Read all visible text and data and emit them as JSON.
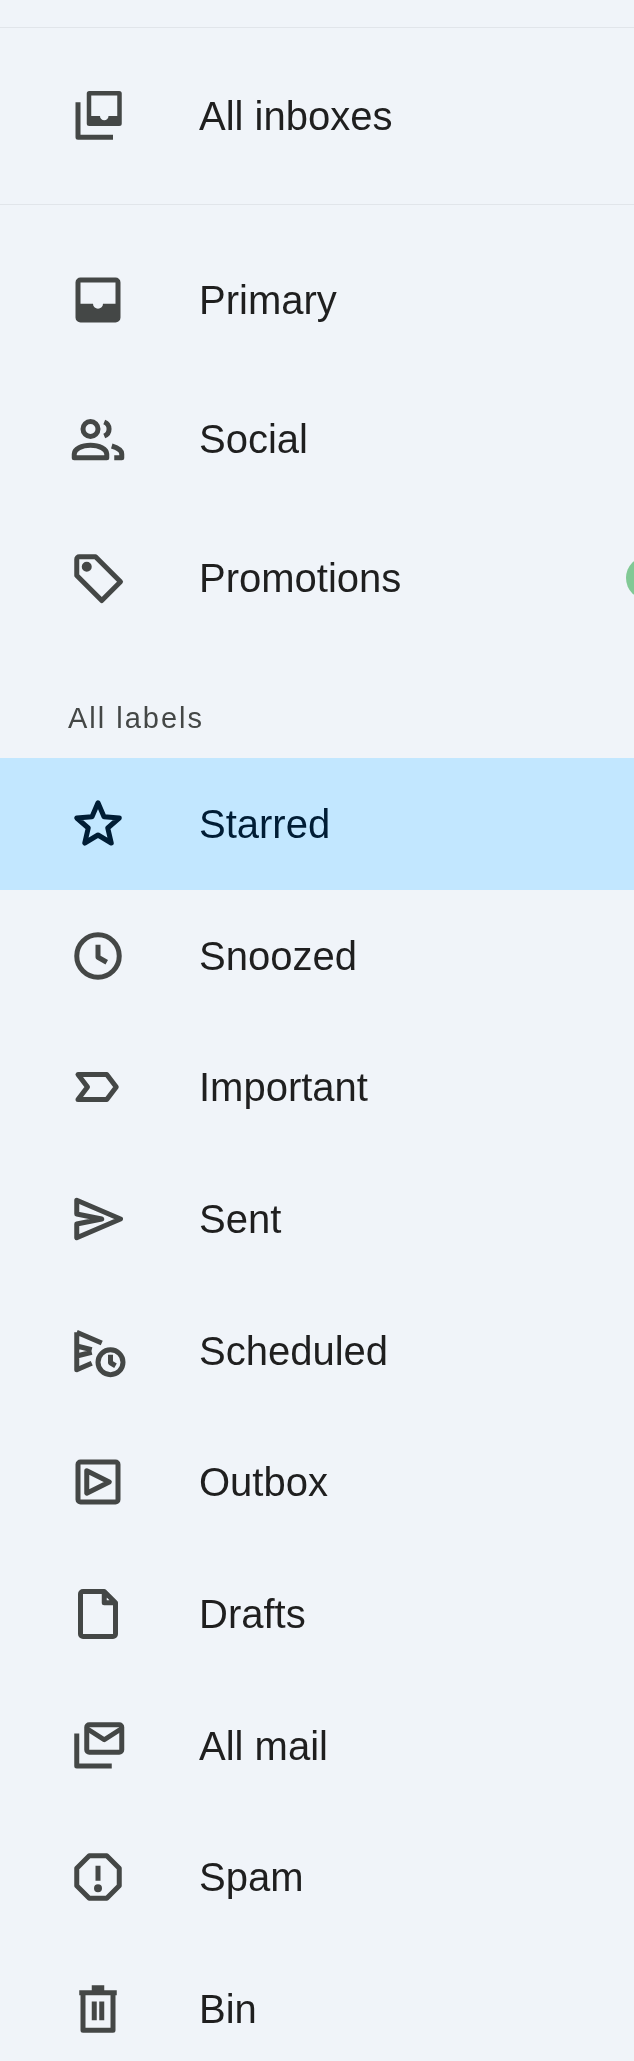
{
  "top_items": [
    {
      "label": "All inboxes",
      "selected": false
    }
  ],
  "categories": [
    {
      "label": "Primary",
      "selected": false,
      "badge": false
    },
    {
      "label": "Social",
      "selected": false,
      "badge": false
    },
    {
      "label": "Promotions",
      "selected": false,
      "badge": true
    }
  ],
  "labels_header": "All labels",
  "labels": [
    {
      "label": "Starred",
      "selected": true
    },
    {
      "label": "Snoozed",
      "selected": false
    },
    {
      "label": "Important",
      "selected": false
    },
    {
      "label": "Sent",
      "selected": false
    },
    {
      "label": "Scheduled",
      "selected": false
    },
    {
      "label": "Outbox",
      "selected": false
    },
    {
      "label": "Drafts",
      "selected": false
    },
    {
      "label": "All mail",
      "selected": false
    },
    {
      "label": "Spam",
      "selected": false
    },
    {
      "label": "Bin",
      "selected": false
    }
  ]
}
